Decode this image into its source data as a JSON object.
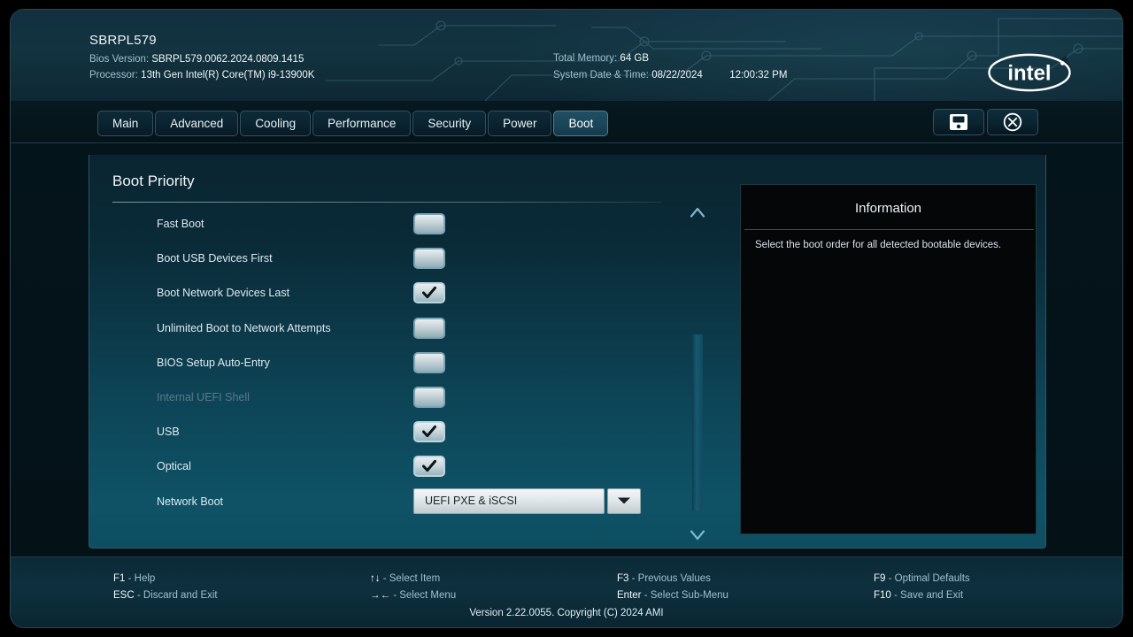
{
  "header": {
    "model": "SBRPL579",
    "bios_version_label": "Bios Version:",
    "bios_version_value": "SBRPL579.0062.2024.0809.1415",
    "processor_label": "Processor:",
    "processor_value": "13th Gen Intel(R) Core(TM) i9-13900K",
    "total_memory_label": "Total Memory:",
    "total_memory_value": "64 GB",
    "datetime_label": "System Date & Time:",
    "date_value": "08/22/2024",
    "time_value": "12:00:32 PM",
    "logo_text": "intel"
  },
  "tabs": [
    {
      "label": "Main",
      "active": false
    },
    {
      "label": "Advanced",
      "active": false
    },
    {
      "label": "Cooling",
      "active": false
    },
    {
      "label": "Performance",
      "active": false
    },
    {
      "label": "Security",
      "active": false
    },
    {
      "label": "Power",
      "active": false
    },
    {
      "label": "Boot",
      "active": true
    }
  ],
  "window_buttons": [
    {
      "name": "save-button",
      "icon": "save-icon"
    },
    {
      "name": "close-button",
      "icon": "close-circle-icon"
    }
  ],
  "back_button": {
    "label": "<"
  },
  "panel": {
    "title": "Boot Priority"
  },
  "settings": [
    {
      "label": "Fast Boot",
      "type": "checkbox",
      "checked": false,
      "disabled": false
    },
    {
      "label": "Boot USB Devices First",
      "type": "checkbox",
      "checked": false,
      "disabled": false
    },
    {
      "label": "Boot Network Devices Last",
      "type": "checkbox",
      "checked": true,
      "disabled": false
    },
    {
      "label": "Unlimited Boot to Network Attempts",
      "type": "checkbox",
      "checked": false,
      "disabled": false
    },
    {
      "label": "BIOS Setup Auto-Entry",
      "type": "checkbox",
      "checked": false,
      "disabled": false
    },
    {
      "label": "Internal UEFI Shell",
      "type": "checkbox",
      "checked": false,
      "disabled": true
    },
    {
      "label": "USB",
      "type": "checkbox",
      "checked": true,
      "disabled": false
    },
    {
      "label": "Optical",
      "type": "checkbox",
      "checked": true,
      "disabled": false
    },
    {
      "label": "Network Boot",
      "type": "dropdown",
      "value": "UEFI PXE & iSCSI",
      "disabled": false
    }
  ],
  "information": {
    "title": "Information",
    "text": "Select the boot order for all detected bootable devices."
  },
  "footer_hints": [
    {
      "key": "F1",
      "desc": "- Help"
    },
    {
      "key": "ESC",
      "desc": "- Discard and Exit"
    },
    {
      "key": "↑↓",
      "desc": "- Select Item"
    },
    {
      "key": "→←",
      "desc": "- Select Menu"
    },
    {
      "key": "F3",
      "desc": "- Previous Values"
    },
    {
      "key": "Enter",
      "desc": "- Select Sub-Menu"
    },
    {
      "key": "F9",
      "desc": "- Optimal Defaults"
    },
    {
      "key": "F10",
      "desc": "- Save and Exit"
    }
  ],
  "version_line": "Version 2.22.0055. Copyright (C) 2024 AMI",
  "colors": {
    "accent_teal": "#0f5266",
    "panel_dark": "#0a2531",
    "text_primary": "#eef4f7",
    "text_muted": "#9fc0cf",
    "disabled_text": "#5c7a87"
  }
}
